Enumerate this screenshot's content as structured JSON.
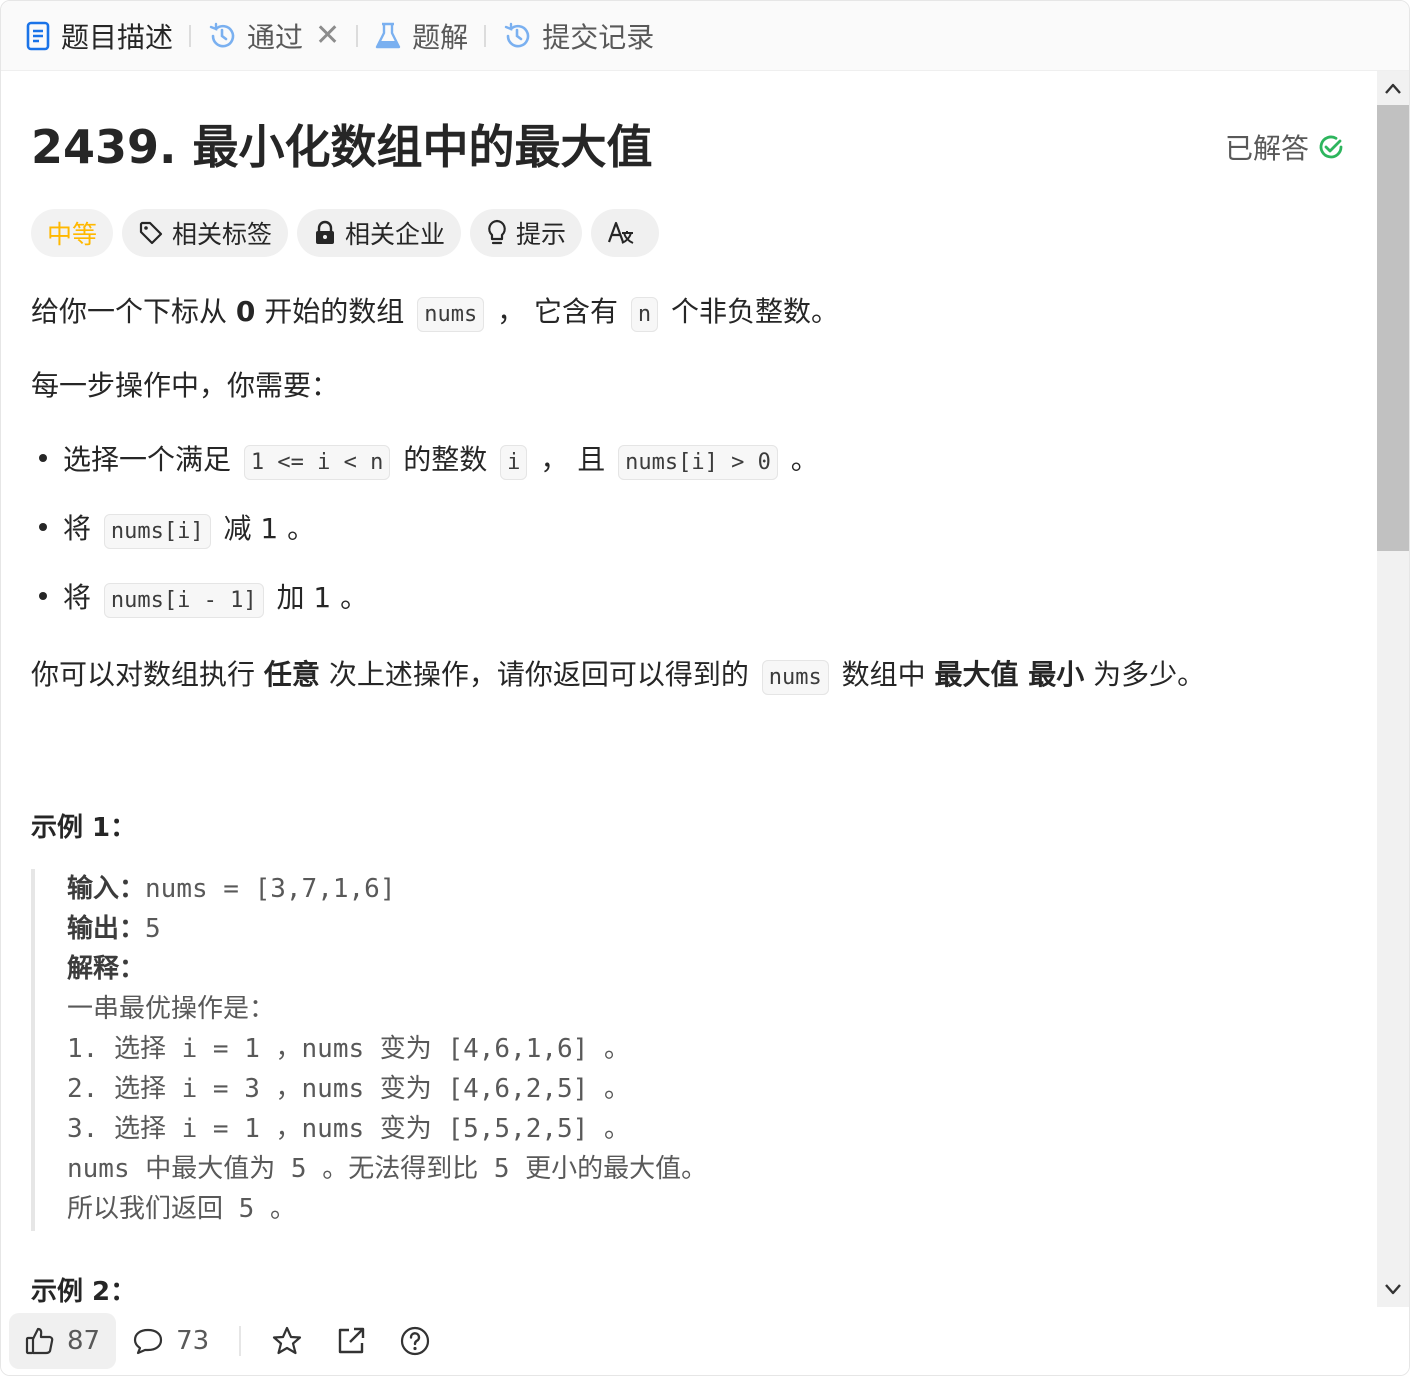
{
  "tabs": [
    {
      "label": "题目描述",
      "icon": "description-icon",
      "active": true
    },
    {
      "label": "通过",
      "icon": "history-icon",
      "closable": true
    },
    {
      "label": "题解",
      "icon": "flask-icon"
    },
    {
      "label": "提交记录",
      "icon": "history-icon"
    }
  ],
  "tab_close_glyph": "✕",
  "problem": {
    "title": "2439. 最小化数组中的最大值",
    "status": "已解答",
    "difficulty": "中等",
    "tags": [
      "相关标签",
      "相关企业",
      "提示"
    ]
  },
  "description": {
    "p1": {
      "a": "给你一个下标从 ",
      "b": "0",
      "c": " 开始的数组 ",
      "code1": "nums",
      "d": " ， 它含有 ",
      "code2": "n",
      "e": " 个非负整数。"
    },
    "p2": "每一步操作中，你需要：",
    "bullet1": {
      "a": "选择一个满足 ",
      "code1": "1 <= i < n",
      "b": " 的整数 ",
      "code2": "i",
      "c": " ， 且 ",
      "code3": "nums[i] > 0",
      "d": " 。"
    },
    "bullet2": {
      "a": "将 ",
      "code1": "nums[i]",
      "b": " 减 1 。"
    },
    "bullet3": {
      "a": "将 ",
      "code1": "nums[i - 1]",
      "b": " 加 1 。"
    },
    "p3": {
      "a": "你可以对数组执行 ",
      "b": "任意",
      "c": " 次上述操作，请你返回可以得到的 ",
      "code1": "nums",
      "d": " 数组中 ",
      "e": "最大值 最小",
      "f": " 为多少。"
    }
  },
  "example1": {
    "heading": "示例 1：",
    "input_label": "输入：",
    "input_value": "nums = [3,7,1,6]",
    "output_label": "输出：",
    "output_value": "5",
    "explain_label": "解释：",
    "lines": [
      "一串最优操作是：",
      "1. 选择 i = 1 ，nums 变为 [4,6,1,6] 。",
      "2. 选择 i = 3 ，nums 变为 [4,6,2,5] 。",
      "3. 选择 i = 1 ，nums 变为 [5,5,2,5] 。",
      "nums 中最大值为 5 。无法得到比 5 更小的最大值。",
      "所以我们返回 5 。"
    ]
  },
  "example2": {
    "heading": "示例 2："
  },
  "toolbar": {
    "likes": "87",
    "comments": "73"
  },
  "colors": {
    "accent_blue": "#1a73e8",
    "difficulty_medium": "#ffb800",
    "solved_green": "#2db55d"
  }
}
